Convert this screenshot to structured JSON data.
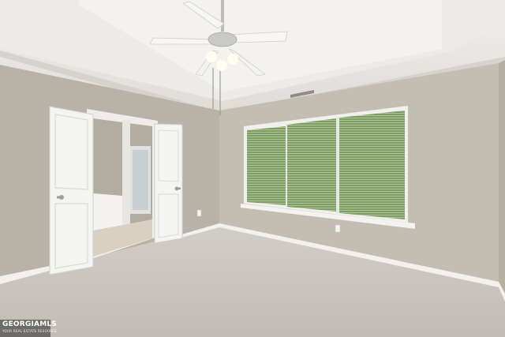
{
  "watermark": {
    "main": "GEORGIAMLS",
    "sub": "YOUR REAL ESTATE RESOURCE"
  },
  "colors": {
    "wall": "#bdb6ab",
    "wall_right": "#c3bcb1",
    "ceiling": "#e9e8e4",
    "carpet": "#c9c4bf",
    "trim": "#f4f4f2",
    "window_green": "#6b8f4e"
  },
  "icons": [
    "ceiling-fan-icon",
    "door-handle-icon",
    "air-vent-icon",
    "electrical-outlet-icon"
  ]
}
